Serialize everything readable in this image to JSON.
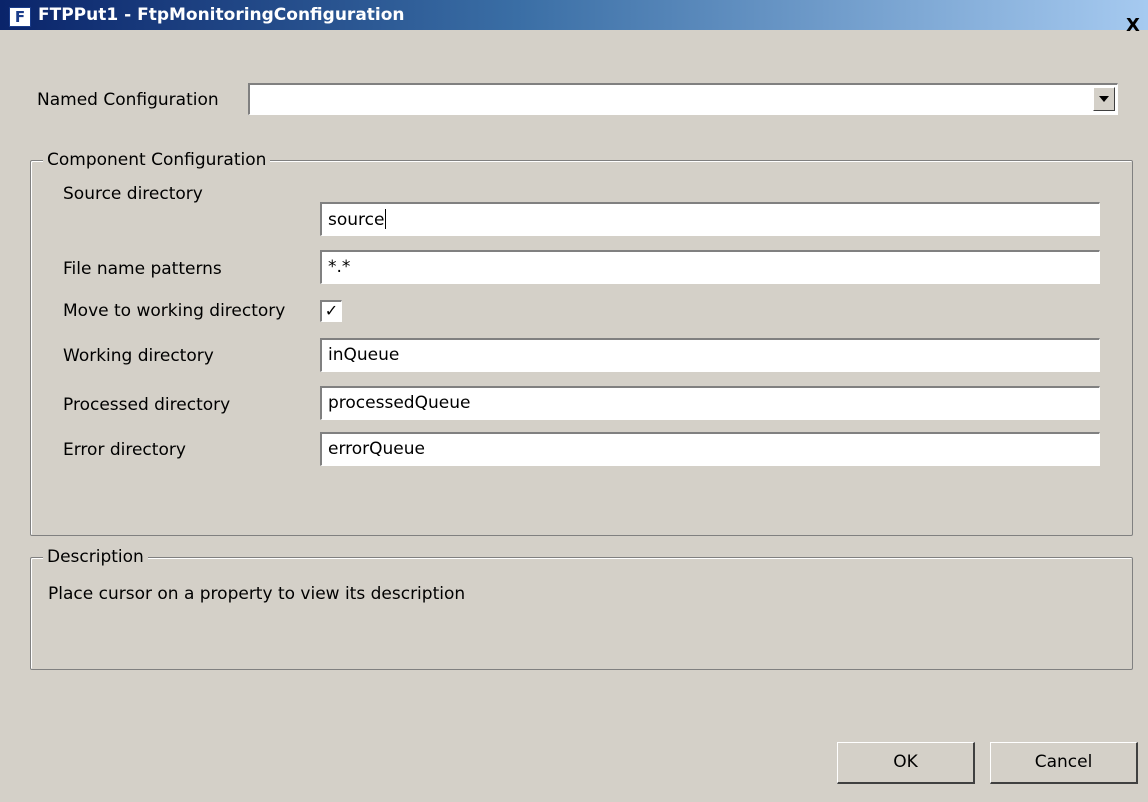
{
  "window": {
    "title": "FTPPut1 - FtpMonitoringConfiguration",
    "icon_letter": "F",
    "close_label": "X"
  },
  "named_configuration": {
    "label": "Named Configuration",
    "value": ""
  },
  "component_configuration": {
    "legend": "Component Configuration",
    "fields": [
      {
        "label": "Source directory",
        "value": "source"
      },
      {
        "label": "File name patterns",
        "value": "*.*"
      },
      {
        "label": "Move to working directory",
        "checked": true,
        "check_glyph": "✓"
      },
      {
        "label": "Working directory",
        "value": "inQueue"
      },
      {
        "label": "Processed directory",
        "value": "processedQueue"
      },
      {
        "label": "Error directory",
        "value": "errorQueue"
      }
    ]
  },
  "description": {
    "legend": "Description",
    "text": "Place cursor on a property to view its description"
  },
  "buttons": {
    "ok_label": "OK",
    "cancel_label": "Cancel"
  }
}
